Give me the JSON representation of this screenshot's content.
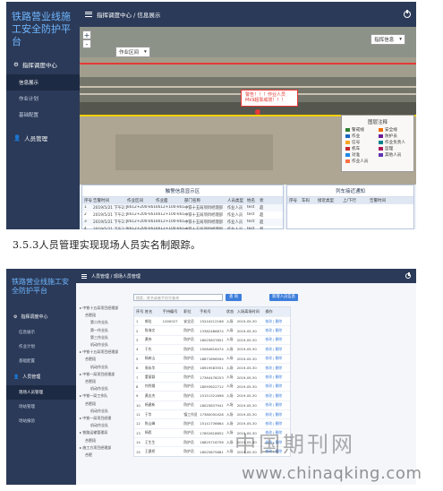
{
  "screen1": {
    "brand": "铁路营业线施工安全防护平台",
    "menu": {
      "group1": "指挥调度中心",
      "items": [
        "信息展示",
        "作业计划",
        "基础配置"
      ],
      "group2": "人员管理"
    },
    "breadcrumb": "指挥调度中心 / 信息展示",
    "map": {
      "zoom_in": "+",
      "zoom_out": "-",
      "section_select": "作业区间",
      "scope_select": "指挥信息",
      "alert": "警告！！！作业人员Mk9超靠威境！！！",
      "legend_title": "图层注释",
      "legend": [
        {
          "label": "警戒线",
          "color": "#2e7d32"
        },
        {
          "label": "安全线",
          "color": "#ef6c00"
        },
        {
          "label": "作业",
          "color": "#1565c0"
        },
        {
          "label": "防护员",
          "color": "#6a1b9a"
        },
        {
          "label": "信号",
          "color": "#f9a825"
        },
        {
          "label": "作业负责人",
          "color": "#00838f"
        },
        {
          "label": "机车",
          "color": "#c62828"
        },
        {
          "label": "监理",
          "color": "#ad1457"
        },
        {
          "label": "对准",
          "color": "#1e88e5"
        },
        {
          "label": "其他人员",
          "color": "#5e35b1"
        },
        {
          "label": "作业人员",
          "color": "#ff7043"
        }
      ]
    },
    "panel_left": {
      "title": "触警信息显示区",
      "headers": [
        "序号",
        "告警时间",
        "作业区间",
        "作业面",
        "部门名称",
        "人员类型",
        "姓名",
        "状"
      ],
      "rows": [
        [
          "1",
          "2019/5/21 下午2:15:25",
          "k612+200-k61...",
          "k612+100-k61...",
          "中铁十五局项目经理部",
          "作业人员",
          "test",
          "超"
        ],
        [
          "2",
          "2019/5/21 下午2:15:37",
          "k612+200-k61...",
          "k612+100-k61...",
          "中铁十五局项目经理部",
          "作业人员",
          "test",
          "超"
        ],
        [
          "3",
          "2019/5/21 下午2:15:48",
          "k612+200-k61...",
          "k612+100-k61...",
          "中铁十五局项目经理部",
          "作业人员",
          "test",
          "超"
        ],
        [
          "4",
          "2019/5/21 下午2:16:00",
          "k612+200-k61...",
          "k612+100-k61...",
          "中铁十五局项目经理部",
          "作业人员",
          "test",
          "超"
        ],
        [
          "5",
          "2019/5/21 下午2:16:11",
          "k612+200-k61...",
          "k612+100-k61...",
          "中铁十五局项目经理部",
          "作业人员",
          "test",
          "超"
        ]
      ]
    },
    "panel_right": {
      "title": "列车接近通知",
      "headers": [
        "序号",
        "车码",
        "接近类型",
        "上/下行",
        "告警时间"
      ]
    }
  },
  "caption": "3.5.3人员管理实现现场人员实名制跟踪。",
  "screen2": {
    "brand": "铁路营业线施工安全防护平台",
    "menu": {
      "group1": "指挥调度中心",
      "items": [
        "信息展示",
        "作业计划",
        "基础配置"
      ],
      "group2": "人员管理",
      "sub_items": [
        "现场人员管理",
        "场站管理",
        "场站报验"
      ]
    },
    "breadcrumb": "人员管理 / 现场人员管理",
    "search_placeholder": "搜索，姓名或者手机号查询",
    "search_button": "查 询",
    "add_button": "新增人员信息",
    "tree": [
      "中铁十五局项目经理部",
      "合肥段",
      "第二作业队",
      "第一作业队",
      "第三作业队",
      "机动作业队",
      "中铁十五局项目经理部",
      "合肥段",
      "机动作业队",
      "中铁一局项目经理部",
      "合肥段",
      "机动作业队",
      "中铁一局工作队",
      "合肥段",
      "机动作业队",
      "中铁一局项目经理",
      "机动作业队",
      "铁路运输管理局",
      "合肥段",
      "施工方项目经理部",
      "合肥"
    ],
    "table": {
      "headers": [
        "序号",
        "姓名",
        "手持编号",
        "职位",
        "手机号",
        "状态",
        "入场离场时间",
        "操作"
      ],
      "rows": [
        [
          "1",
          "郭佳",
          "1000027",
          "安全员",
          "15244212166",
          "入场",
          "2019-05-30",
          "修改 | 删除"
        ],
        [
          "2",
          "陈海文",
          "",
          "防护员",
          "13382486874",
          "入场",
          "2019-05-30",
          "修改 | 删除"
        ],
        [
          "3",
          "黄伟",
          "",
          "防护员",
          "18025837851",
          "入场",
          "2019-05-30",
          "修改 | 删除"
        ],
        [
          "4",
          "于先",
          "",
          "防护员",
          "15084816474",
          "入场",
          "2019-05-30",
          "修改 | 删除"
        ],
        [
          "5",
          "杨树山",
          "",
          "防护员",
          "18871896594",
          "入场",
          "2019-05-30",
          "修改 | 删除"
        ],
        [
          "6",
          "周永华",
          "",
          "防护员",
          "18919583551",
          "入场",
          "2019-05-30",
          "修改 | 删除"
        ],
        [
          "7",
          "董丽颖",
          "",
          "防护员",
          "17364478253",
          "入场",
          "2019-05-30",
          "修改 | 删除"
        ],
        [
          "8",
          "何秀娥",
          "",
          "防护员",
          "18093622712",
          "入场",
          "2019-05-30",
          "修改 | 删除"
        ],
        [
          "9",
          "黄志杰",
          "",
          "防护员",
          "15151321698",
          "入场",
          "2019-05-30",
          "修改 | 删除"
        ],
        [
          "10",
          "杨建新",
          "",
          "防护员",
          "18025837941",
          "入场",
          "2019-05-30",
          "修改 | 删除"
        ],
        [
          "11",
          "于华",
          "",
          "镇工作员",
          "17380050428",
          "入场",
          "2019-05-30",
          "修改 | 删除"
        ],
        [
          "12",
          "陈山峰",
          "",
          "防护员",
          "15141736664",
          "入场",
          "2019-05-30",
          "修改 | 删除"
        ],
        [
          "13",
          "杨毅",
          "",
          "防护员",
          "17652618652",
          "入场",
          "2019-05-30",
          "修改 | 删除"
        ],
        [
          "14",
          "王生生",
          "",
          "防护员",
          "18825716756",
          "入场",
          "2019-05-30",
          "修改 | 删除"
        ],
        [
          "15",
          "王建桥",
          "",
          "防护员",
          "18025875681",
          "入场",
          "2019-05-30",
          "修改 | 删除"
        ]
      ]
    }
  },
  "watermark_cn": "中国期刊网",
  "watermark_url": "www.chinaqking.com"
}
